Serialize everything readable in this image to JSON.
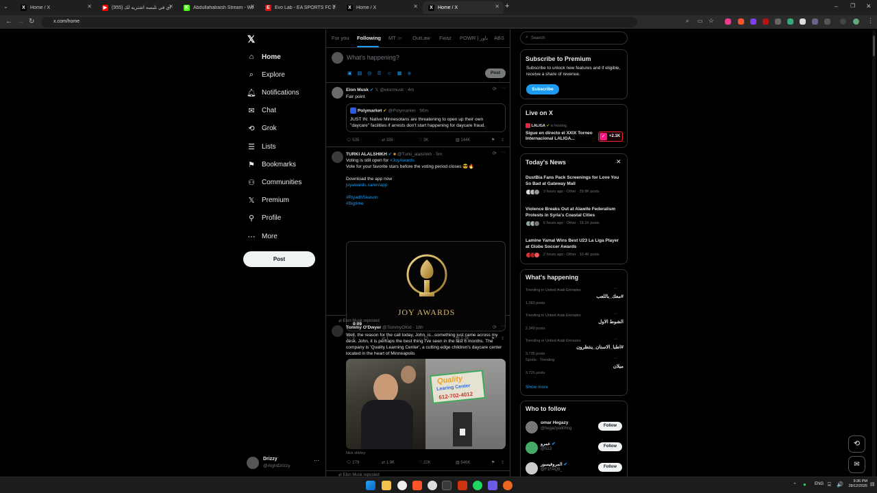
{
  "browser": {
    "tabs": [
      {
        "title": "Home / X",
        "favicon": "X",
        "color": "#000000"
      },
      {
        "title": "اي في تلبسه اشتريه لك (955)",
        "favicon": "▶",
        "color": "#ff0000"
      },
      {
        "title": "Abdullahalraish Stream - Watch",
        "favicon": "K",
        "color": "#53fc18"
      },
      {
        "title": "Evo Lab - EA SPORTS FC 26 - Fi",
        "favicon": "E",
        "color": "#d11"
      },
      {
        "title": "Home / X",
        "favicon": "X",
        "color": "#000000"
      },
      {
        "title": "Home / X",
        "favicon": "X",
        "color": "#000000"
      }
    ],
    "url": "x.com/home"
  },
  "sidebar": {
    "items": [
      {
        "label": "Home",
        "icon": "home-icon"
      },
      {
        "label": "Explore",
        "icon": "search-icon"
      },
      {
        "label": "Notifications",
        "icon": "bell-icon"
      },
      {
        "label": "Chat",
        "icon": "mail-icon"
      },
      {
        "label": "Grok",
        "icon": "grok-icon"
      },
      {
        "label": "Lists",
        "icon": "list-icon"
      },
      {
        "label": "Bookmarks",
        "icon": "bookmark-icon"
      },
      {
        "label": "Communities",
        "icon": "people-icon"
      },
      {
        "label": "Premium",
        "icon": "x-logo-icon"
      },
      {
        "label": "Profile",
        "icon": "person-icon"
      },
      {
        "label": "More",
        "icon": "more-icon"
      }
    ],
    "post_button": "Post",
    "account": {
      "name": "Drizzy",
      "handle": "@AlghtDrizzy"
    }
  },
  "feed": {
    "tabs": [
      "For you",
      "Following",
      "MT",
      "OutLaw",
      "Fwaz",
      "POWR | باور",
      "ABS"
    ],
    "tab_badges": {
      "MT": "1H"
    },
    "composer_placeholder": "What's happening?",
    "composer_post": "Post",
    "posts": [
      {
        "name": "Elon Musk",
        "handle": "@elonmusk",
        "time": "4m",
        "text": "Fair point",
        "quote": {
          "name": "Polymarket",
          "handle": "@Polymarket",
          "time": "56m",
          "text": "JUST IN: Native Minnesotans are threatening to open up their own \"daycare\" facilities if arrests don't start happening for daycare fraud."
        },
        "stats": {
          "replies": "535",
          "reposts": "338",
          "likes": "3K",
          "views": "144K"
        }
      },
      {
        "name": "TURKI ALALSHIKH",
        "handle": "@Turki_alalshikh",
        "time": "5m",
        "line1a": "Voting is still open for",
        "line1b": "#JoyAwards",
        "line2": "Vote for your favorite stars before the voting period closes 😎🔥",
        "line3": "Download the app now",
        "link": "joyawards.sa/en/app",
        "tag1": "#RiyadhSeason",
        "tag2": "#Bigtime",
        "media_title": "JOY AWARDS",
        "media_time": "0:09",
        "stats": {
          "replies": "3",
          "reposts": "1",
          "likes": "10",
          "views": "2.7K"
        }
      },
      {
        "repost_by": "Elon Musk reposted",
        "name": "Tommy O'Dwyer",
        "handle": "@TommyOKid",
        "time": "18h",
        "text": "Well, the reason for the call today, John, is...something just came across my desk. John, it is perhaps the best thing I've seen in the last 6 months. The company is 'Quality Learning Center', a cutting edge children's daycare center located in the heart of Minneapolis",
        "sign_l1": "Quality",
        "sign_l2": "Learing Center",
        "sign_l3": "612-702-4012",
        "media_caption": "Nick shirley",
        "stats": {
          "replies": "279",
          "reposts": "1.9K",
          "likes": "22K",
          "views": "546K"
        }
      }
    ],
    "next_repost": "Elon Musk reposted"
  },
  "right": {
    "search_placeholder": "Search",
    "premium": {
      "title": "Subscribe to Premium",
      "text": "Subscribe to unlock new features and if eligible, receive a share of revenue.",
      "button": "Subscribe"
    },
    "live": {
      "title": "Live on X",
      "host": "LALIGA",
      "hosting": "is hosting",
      "text": "Sigue en directo el XXIX Torneo Internacional LALIGA...",
      "count": "+2.1K"
    },
    "news": {
      "title": "Today's News",
      "items": [
        {
          "title": "DustBia Fans Pack Screenings for Love You So Bad at Gateway Mall",
          "meta": "3 hours ago · Other · 29.9K posts"
        },
        {
          "title": "Violence Breaks Out at Alawite Federalism Protests in Syria's Coastal Cities",
          "meta": "6 hours ago · Other · 19.1K posts"
        },
        {
          "title": "Lamine Yamal Wins Best U23 La Liga Player at Globe Soccer Awards",
          "meta": "2 hours ago · Other · 10.4K posts"
        }
      ]
    },
    "happening": {
      "title": "What's happening",
      "items": [
        {
          "context": "Trending in United Arab Emirates",
          "tag": "#معك_باللعب",
          "posts": "1,093 posts"
        },
        {
          "context": "Trending in United Arab Emirates",
          "tag": "الشوط الاول",
          "posts": "2,349 posts"
        },
        {
          "context": "Trending in United Arab Emirates",
          "tag": "#اطبا_الاسنان_ينتظرون",
          "posts": "3,735 posts"
        },
        {
          "context": "Sports · Trending",
          "tag": "ميلان",
          "posts": "3,725 posts"
        }
      ],
      "show_more": "Show more"
    },
    "follow": {
      "title": "Who to follow",
      "button": "Follow",
      "items": [
        {
          "name": "omar Hegazy",
          "handle": "@hegazyed0hng"
        },
        {
          "name": "عمرو",
          "handle": "@513"
        },
        {
          "name": "المروفيسور",
          "handle": "@F1FAQ8_"
        }
      ]
    }
  },
  "taskbar": {
    "lang": "ENG",
    "time": "9:36 PM",
    "date": "28/12/2025"
  }
}
